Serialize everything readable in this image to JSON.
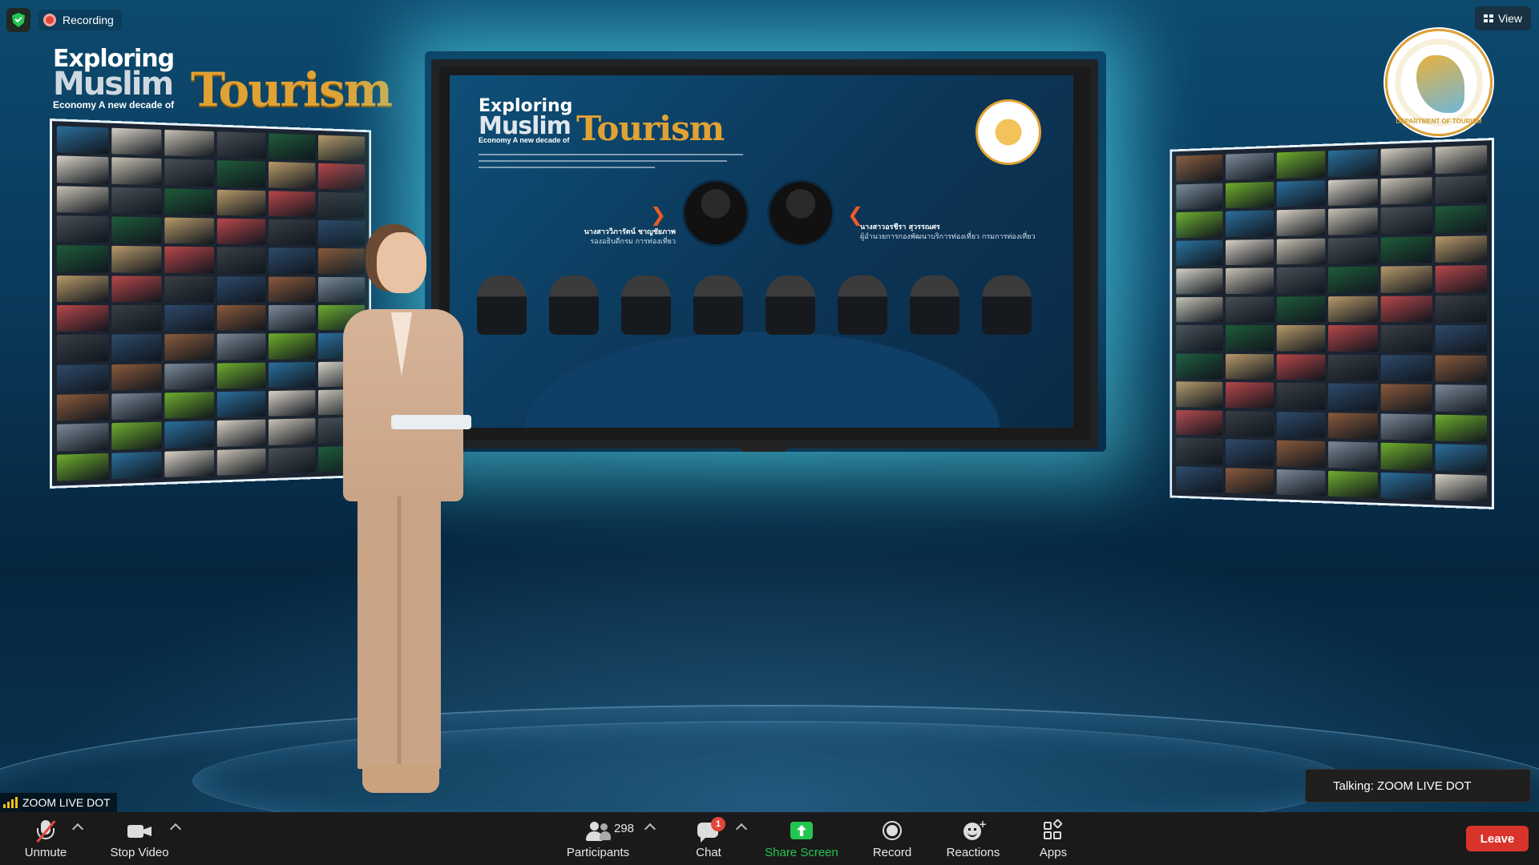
{
  "recording": {
    "label": "Recording"
  },
  "view": {
    "label": "View"
  },
  "event": {
    "title_line1": "Exploring",
    "title_line2": "Muslim",
    "title_line3": "Tourism",
    "subtitle": "Economy A new decade of"
  },
  "seal": {
    "text": "DEPARTMENT OF TOURISM"
  },
  "slide": {
    "title_line1": "Exploring",
    "title_line2": "Muslim",
    "title_line3": "Tourism",
    "subtitle": "Economy A new decade of",
    "speaker_left": {
      "name": "นางสาววิภารัตน์ ชาญชัยภาพ",
      "role": "รองอธิบดีกรม การท่องเที่ยว"
    },
    "speaker_right": {
      "name": "นางสาวอรชีรา สุวรรณศร",
      "role": "ผู้อำนวยการกองพัฒนาบริการท่องเที่ยว กรมการท่องเที่ยว"
    }
  },
  "active_speaker": {
    "name": "ZOOM LIVE DOT"
  },
  "talking": {
    "label": "Talking: ZOOM LIVE DOT"
  },
  "toolbar": {
    "unmute": "Unmute",
    "stop_video": "Stop Video",
    "participants": "Participants",
    "participants_count": "298",
    "chat": "Chat",
    "chat_badge": "1",
    "share_screen": "Share Screen",
    "record": "Record",
    "reactions": "Reactions",
    "apps": "Apps",
    "leave": "Leave"
  },
  "colors": {
    "accent_green": "#23c552",
    "leave_red": "#d9342b",
    "badge_red": "#e0463c",
    "brand_gold": "#e0a235"
  }
}
